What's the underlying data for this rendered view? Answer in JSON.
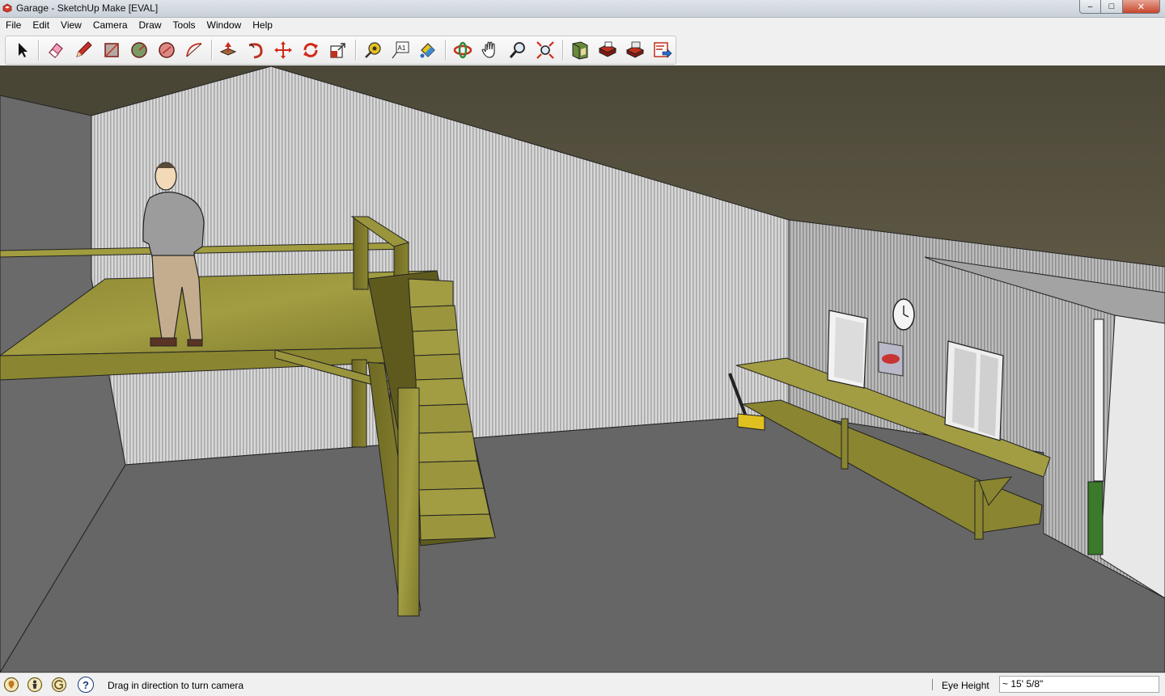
{
  "window": {
    "title": "Garage - SketchUp Make [EVAL]",
    "minimize_glyph": "–",
    "maximize_glyph": "□",
    "close_glyph": "✕"
  },
  "menu": [
    "File",
    "Edit",
    "View",
    "Camera",
    "Draw",
    "Tools",
    "Window",
    "Help"
  ],
  "toolbar": {
    "tools": [
      {
        "name": "select-tool-icon"
      },
      {
        "name": "eraser-tool-icon"
      },
      {
        "name": "pencil-tool-icon"
      },
      {
        "name": "rectangle-tool-icon"
      },
      {
        "name": "circle-tool-icon"
      },
      {
        "name": "polygon-tool-icon"
      },
      {
        "name": "arc-tool-icon"
      },
      {
        "name": "push-pull-tool-icon"
      },
      {
        "name": "follow-me-tool-icon"
      },
      {
        "name": "move-tool-icon"
      },
      {
        "name": "rotate-tool-icon"
      },
      {
        "name": "scale-tool-icon"
      },
      {
        "name": "tape-measure-tool-icon"
      },
      {
        "name": "text-tool-icon",
        "glyph": "A1"
      },
      {
        "name": "paint-bucket-tool-icon"
      },
      {
        "name": "orbit-tool-icon"
      },
      {
        "name": "pan-tool-icon"
      },
      {
        "name": "zoom-tool-icon"
      },
      {
        "name": "zoom-extents-tool-icon"
      },
      {
        "name": "warehouse-icon"
      },
      {
        "name": "components-icon"
      },
      {
        "name": "share-model-icon"
      },
      {
        "name": "extension-warehouse-icon"
      }
    ]
  },
  "status": {
    "message": "Drag in direction to turn camera",
    "help_glyph": "?",
    "eye_height_label": "Eye Height",
    "eye_height_value": "~ 15' 5/8\""
  },
  "colors": {
    "ceiling": "#55503e",
    "floor": "#666666",
    "wall": "#cfcfcf",
    "wood": "#8a8530",
    "wood_light": "#a7a345"
  }
}
